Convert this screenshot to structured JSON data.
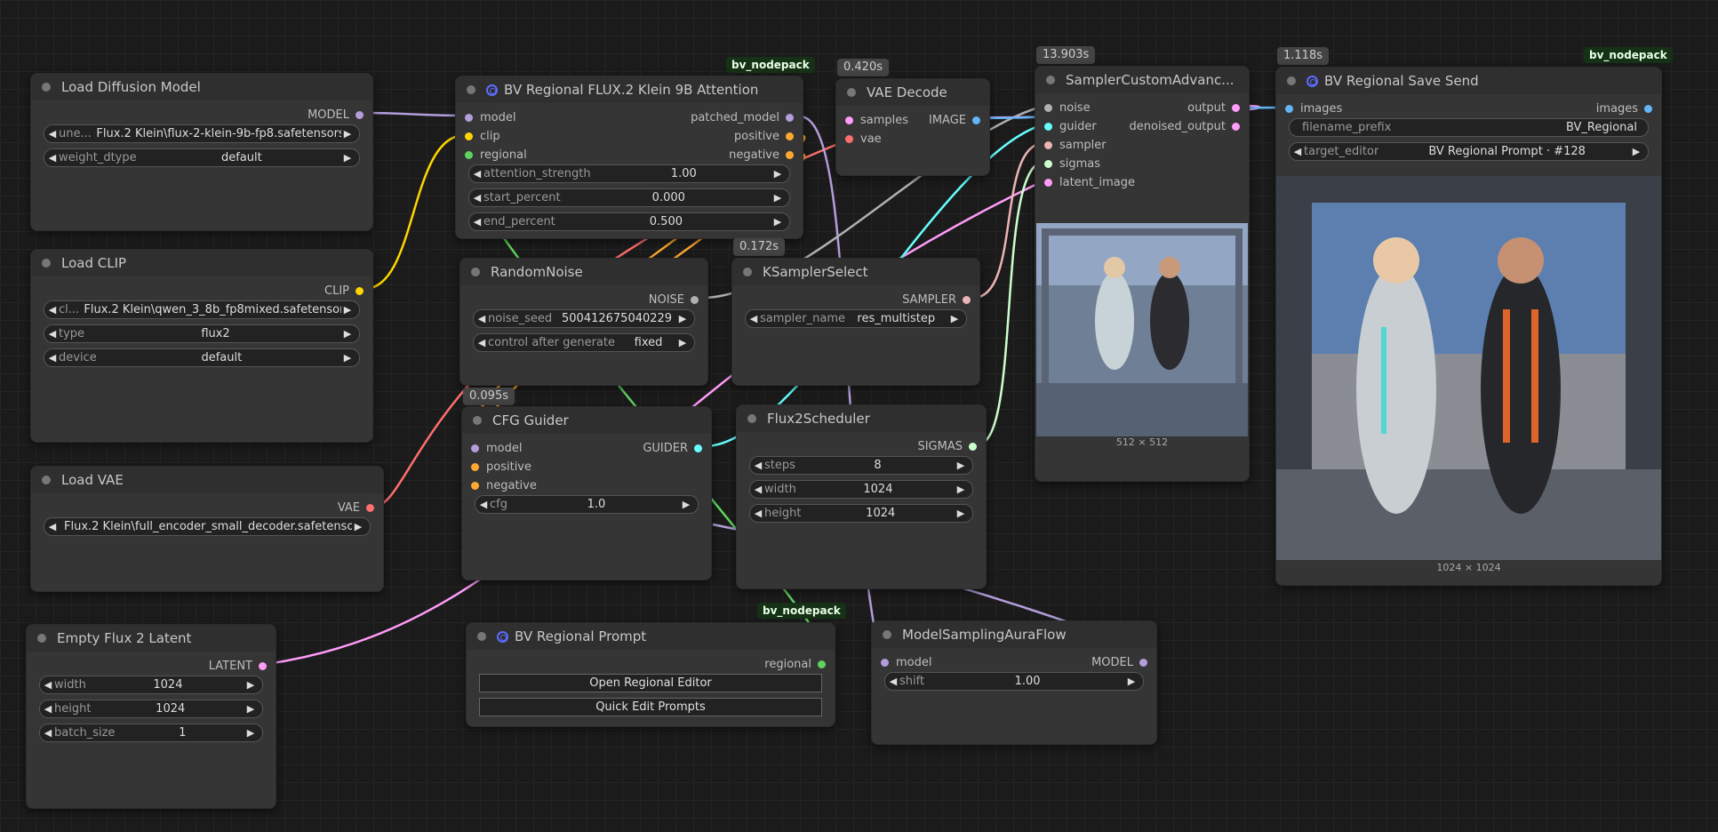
{
  "nodes": {
    "load_diffusion_model": {
      "title": "Load Diffusion Model",
      "output": "MODEL",
      "unet_label": "une...",
      "unet_value": "Flux.2 Klein\\flux-2-klein-9b-fp8.safetensors",
      "weight_dtype_label": "weight_dtype",
      "weight_dtype_value": "default"
    },
    "load_clip": {
      "title": "Load CLIP",
      "output": "CLIP",
      "clip_label": "cl...",
      "clip_value": "Flux.2 Klein\\qwen_3_8b_fp8mixed.safetensors",
      "type_label": "type",
      "type_value": "flux2",
      "device_label": "device",
      "device_value": "default"
    },
    "load_vae": {
      "title": "Load VAE",
      "output": "VAE",
      "vae_value": "Flux.2 Klein\\full_encoder_small_decoder.safetensors"
    },
    "empty_latent": {
      "title": "Empty Flux 2 Latent",
      "output": "LATENT",
      "width_label": "width",
      "width_value": "1024",
      "height_label": "height",
      "height_value": "1024",
      "batch_label": "batch_size",
      "batch_value": "1"
    },
    "bv_attention": {
      "title": "BV Regional FLUX.2 Klein 9B Attention",
      "pack": "bv_nodepack",
      "in_model": "model",
      "in_clip": "clip",
      "in_regional": "regional",
      "out_patched": "patched_model",
      "out_positive": "positive",
      "out_negative": "negative",
      "strength_label": "attention_strength",
      "strength_value": "1.00",
      "start_label": "start_percent",
      "start_value": "0.000",
      "end_label": "end_percent",
      "end_value": "0.500"
    },
    "random_noise": {
      "title": "RandomNoise",
      "output": "NOISE",
      "seed_label": "noise_seed",
      "seed_value": "500412675040229",
      "control_label": "control after generate",
      "control_value": "fixed"
    },
    "ksampler_select": {
      "title": "KSamplerSelect",
      "badge": "0.172s",
      "output": "SAMPLER",
      "sampler_label": "sampler_name",
      "sampler_value": "res_multistep"
    },
    "cfg_guider": {
      "title": "CFG Guider",
      "badge": "0.095s",
      "in_model": "model",
      "in_positive": "positive",
      "in_negative": "negative",
      "output": "GUIDER",
      "cfg_label": "cfg",
      "cfg_value": "1.0"
    },
    "flux2_scheduler": {
      "title": "Flux2Scheduler",
      "output": "SIGMAS",
      "steps_label": "steps",
      "steps_value": "8",
      "width_label": "width",
      "width_value": "1024",
      "height_label": "height",
      "height_value": "1024"
    },
    "vae_decode": {
      "title": "VAE Decode",
      "badge": "0.420s",
      "in_samples": "samples",
      "in_vae": "vae",
      "output": "IMAGE"
    },
    "sampler_custom": {
      "title": "SamplerCustomAdvanc...",
      "badge": "13.903s",
      "in_noise": "noise",
      "in_guider": "guider",
      "in_sampler": "sampler",
      "in_sigmas": "sigmas",
      "in_latent": "latent_image",
      "out_output": "output",
      "out_denoised": "denoised_output",
      "caption": "512 × 512"
    },
    "bv_save_send": {
      "title": "BV Regional Save Send",
      "badge": "1.118s",
      "pack": "bv_nodepack",
      "in_images": "images",
      "out_images": "images",
      "prefix_label": "filename_prefix",
      "prefix_value": "BV_Regional",
      "target_label": "target_editor",
      "target_value": "BV Regional Prompt · #128",
      "caption": "1024 × 1024"
    },
    "bv_prompt": {
      "title": "BV Regional Prompt",
      "pack": "bv_nodepack",
      "output": "regional",
      "btn_open": "Open Regional Editor",
      "btn_quick": "Quick Edit Prompts"
    },
    "model_sampling": {
      "title": "ModelSamplingAuraFlow",
      "in_model": "model",
      "output": "MODEL",
      "shift_label": "shift",
      "shift_value": "1.00"
    }
  },
  "colors": {
    "model": "#b39ddb",
    "clip": "#ffd500",
    "vae": "#ff6e6e",
    "latent": "#ff9cf9",
    "conditioning": "#ffa931",
    "noise": "#b0b0b0",
    "sampler": "#ecb4b4",
    "guider": "#66ffff",
    "sigmas": "#cdffcd",
    "image": "#64b5f6",
    "regional": "#5fd35f"
  }
}
